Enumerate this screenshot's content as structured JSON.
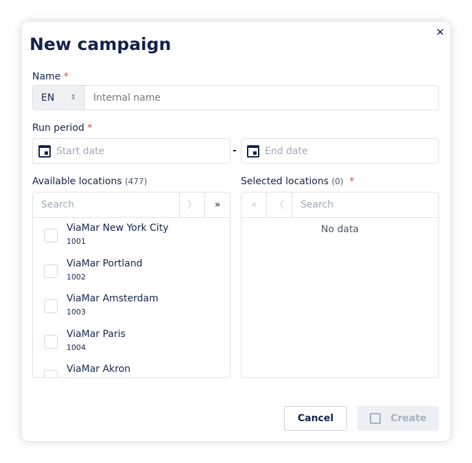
{
  "dialog": {
    "title": "New campaign",
    "close_icon": "close-icon"
  },
  "name": {
    "label": "Name",
    "required": "*",
    "language": "EN",
    "placeholder": "Internal name"
  },
  "run_period": {
    "label": "Run period",
    "required": "*",
    "start_placeholder": "Start date",
    "separator": "-",
    "end_placeholder": "End date"
  },
  "available": {
    "label": "Available locations",
    "count": "(477)",
    "search_placeholder": "Search",
    "items": [
      {
        "name": "ViaMar New York City",
        "code": "1001"
      },
      {
        "name": "ViaMar Portland",
        "code": "1002"
      },
      {
        "name": "ViaMar Amsterdam",
        "code": "1003"
      },
      {
        "name": "ViaMar Paris",
        "code": "1004"
      },
      {
        "name": "ViaMar Akron",
        "code": ""
      }
    ]
  },
  "selected": {
    "label": "Selected locations",
    "count": "(0)",
    "required": "*",
    "search_placeholder": "Search",
    "empty": "No data"
  },
  "footer": {
    "cancel": "Cancel",
    "create": "Create"
  }
}
